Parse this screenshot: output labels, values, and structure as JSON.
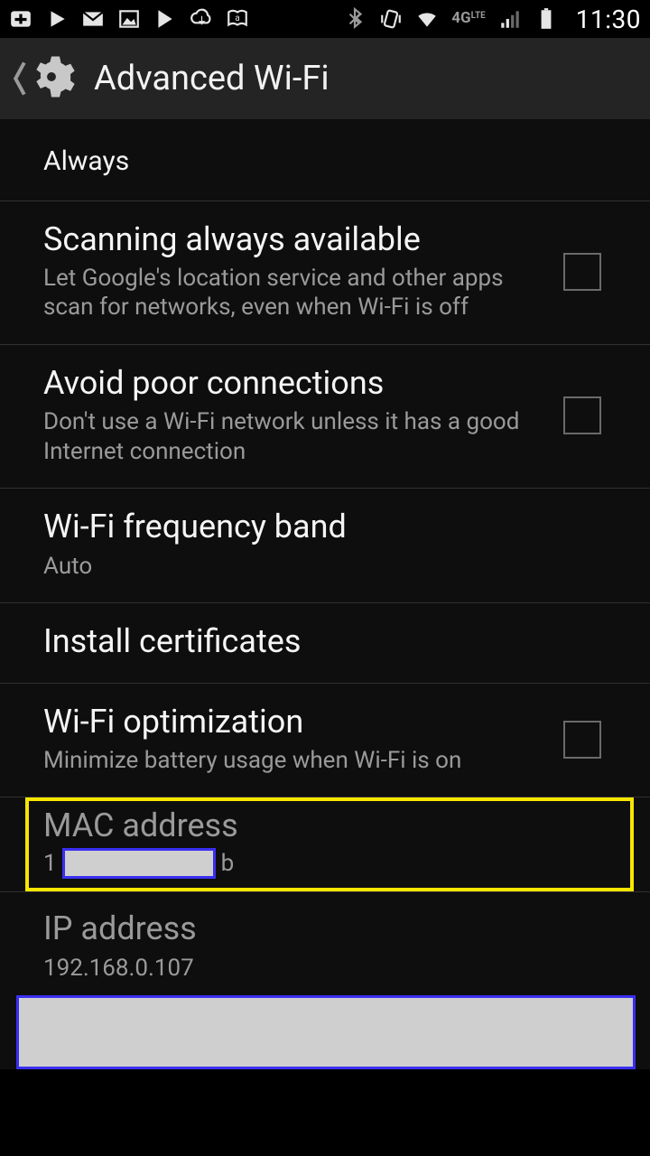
{
  "statusbar": {
    "clock": "11:30"
  },
  "appbar": {
    "title": "Advanced Wi-Fi"
  },
  "items": {
    "always": {
      "subtitle": "Always"
    },
    "scanning": {
      "title": "Scanning always available",
      "subtitle": "Let Google's location service and other apps scan for networks, even when Wi-Fi is off"
    },
    "avoid": {
      "title": "Avoid poor connections",
      "subtitle": "Don't use a Wi-Fi network unless it has a good Internet connection"
    },
    "freq": {
      "title": "Wi-Fi frequency band",
      "subtitle": "Auto"
    },
    "certs": {
      "title": "Install certificates"
    },
    "opt": {
      "title": "Wi-Fi optimization",
      "subtitle": "Minimize battery usage when Wi-Fi is on"
    },
    "mac": {
      "title": "MAC address",
      "prefix": "1",
      "suffix": "b"
    },
    "ip": {
      "title": "IP address",
      "subtitle": "192.168.0.107"
    }
  }
}
